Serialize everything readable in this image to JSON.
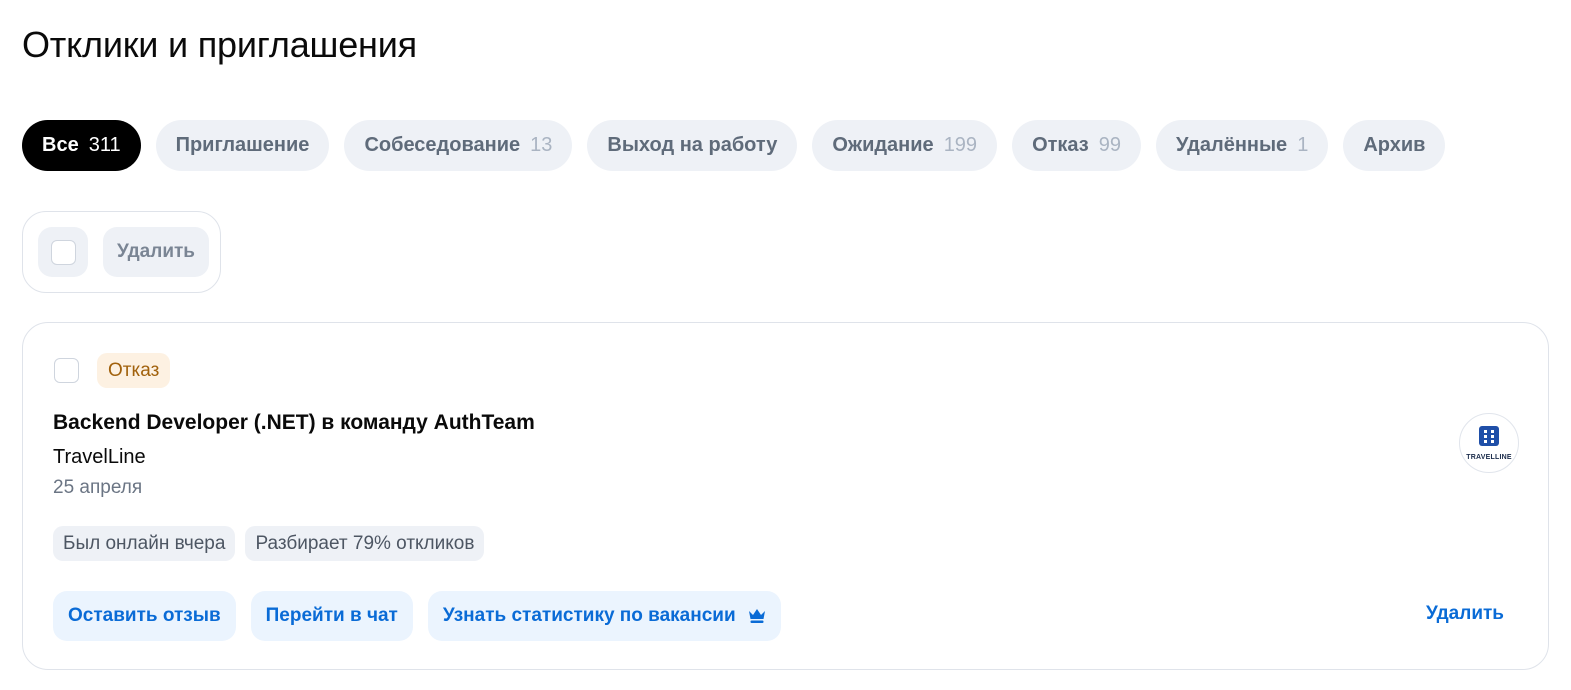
{
  "page": {
    "title": "Отклики и приглашения"
  },
  "tabs": [
    {
      "label": "Все",
      "count": "311",
      "active": true
    },
    {
      "label": "Приглашение",
      "count": ""
    },
    {
      "label": "Собеседование",
      "count": "13"
    },
    {
      "label": "Выход на работу",
      "count": ""
    },
    {
      "label": "Ожидание",
      "count": "199"
    },
    {
      "label": "Отказ",
      "count": "99"
    },
    {
      "label": "Удалённые",
      "count": "1"
    },
    {
      "label": "Архив",
      "count": ""
    }
  ],
  "bulk": {
    "delete_label": "Удалить"
  },
  "card": {
    "status": "Отказ",
    "title": "Backend Developer (.NET) в команду AuthTeam",
    "company": "TravelLine",
    "date": "25 апреля",
    "logo_text": "TRAVELLINE",
    "chips": [
      "Был онлайн вчера",
      "Разбирает 79% откликов"
    ],
    "actions": {
      "feedback": "Оставить отзыв",
      "chat": "Перейти в чат",
      "stats": "Узнать статистику по вакансии"
    },
    "stats_icon": "crown-icon",
    "delete_label": "Удалить"
  },
  "colors": {
    "accent": "#0a6bd6",
    "status_bg": "#fdf1e2",
    "status_text": "#a1610c",
    "tab_active": "#000000",
    "logo_blue": "#1f4fa8"
  }
}
